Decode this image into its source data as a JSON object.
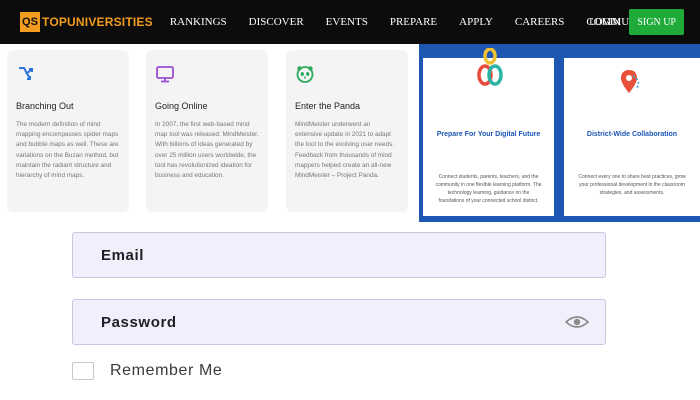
{
  "nav": {
    "logo_badge": "QS",
    "logo_text": "TOPUNIVERSITIES",
    "links": [
      "RANKINGS",
      "DISCOVER",
      "EVENTS",
      "PREPARE",
      "APPLY",
      "CAREERS",
      "COMMUNITY"
    ],
    "login": "LOGIN",
    "signup": "SIGN UP",
    "colors": {
      "bar": "#0c0c0c",
      "logo": "#f39c1f",
      "signup": "#1fab3a"
    }
  },
  "cards": [
    {
      "icon": "branching-arrows-icon",
      "title": "Branching Out",
      "body": "The modern definition of mind mapping encompasses spider maps and bubble maps as well. These are variations on the Buzan method, but maintain the radiant structure and hierarchy of mind maps."
    },
    {
      "icon": "monitor-icon",
      "title": "Going Online",
      "body": "In 2007, the first web-based mind map tool was released: MindMeister. With billions of ideas generated by over 25 million users worldwide, the tool has revolutionized ideation for business and education."
    },
    {
      "icon": "panda-icon",
      "title": "Enter the Panda",
      "body": "MindMeister underwent an extensive update in 2021 to adapt the tool to the evolving user needs. Feedback from thousands of mind mappers helped create an all-new MindMeister – Project Panda."
    }
  ],
  "tiles": [
    {
      "icon": "chain-links-icon",
      "title": "Prepare For Your Digital Future",
      "body": "Connect students, parents, teachers, and the community in one flexible learning platform. The technology learning, guidance on the foundations of your connected school district."
    },
    {
      "icon": "map-pin-icon",
      "title": "District-Wide Collaboration",
      "body": "Connect every one to share best practices, grow your professional development in the classroom strategies, and assessments."
    }
  ],
  "form": {
    "email_label": "Email",
    "password_label": "Password",
    "remember_label": "Remember Me"
  }
}
